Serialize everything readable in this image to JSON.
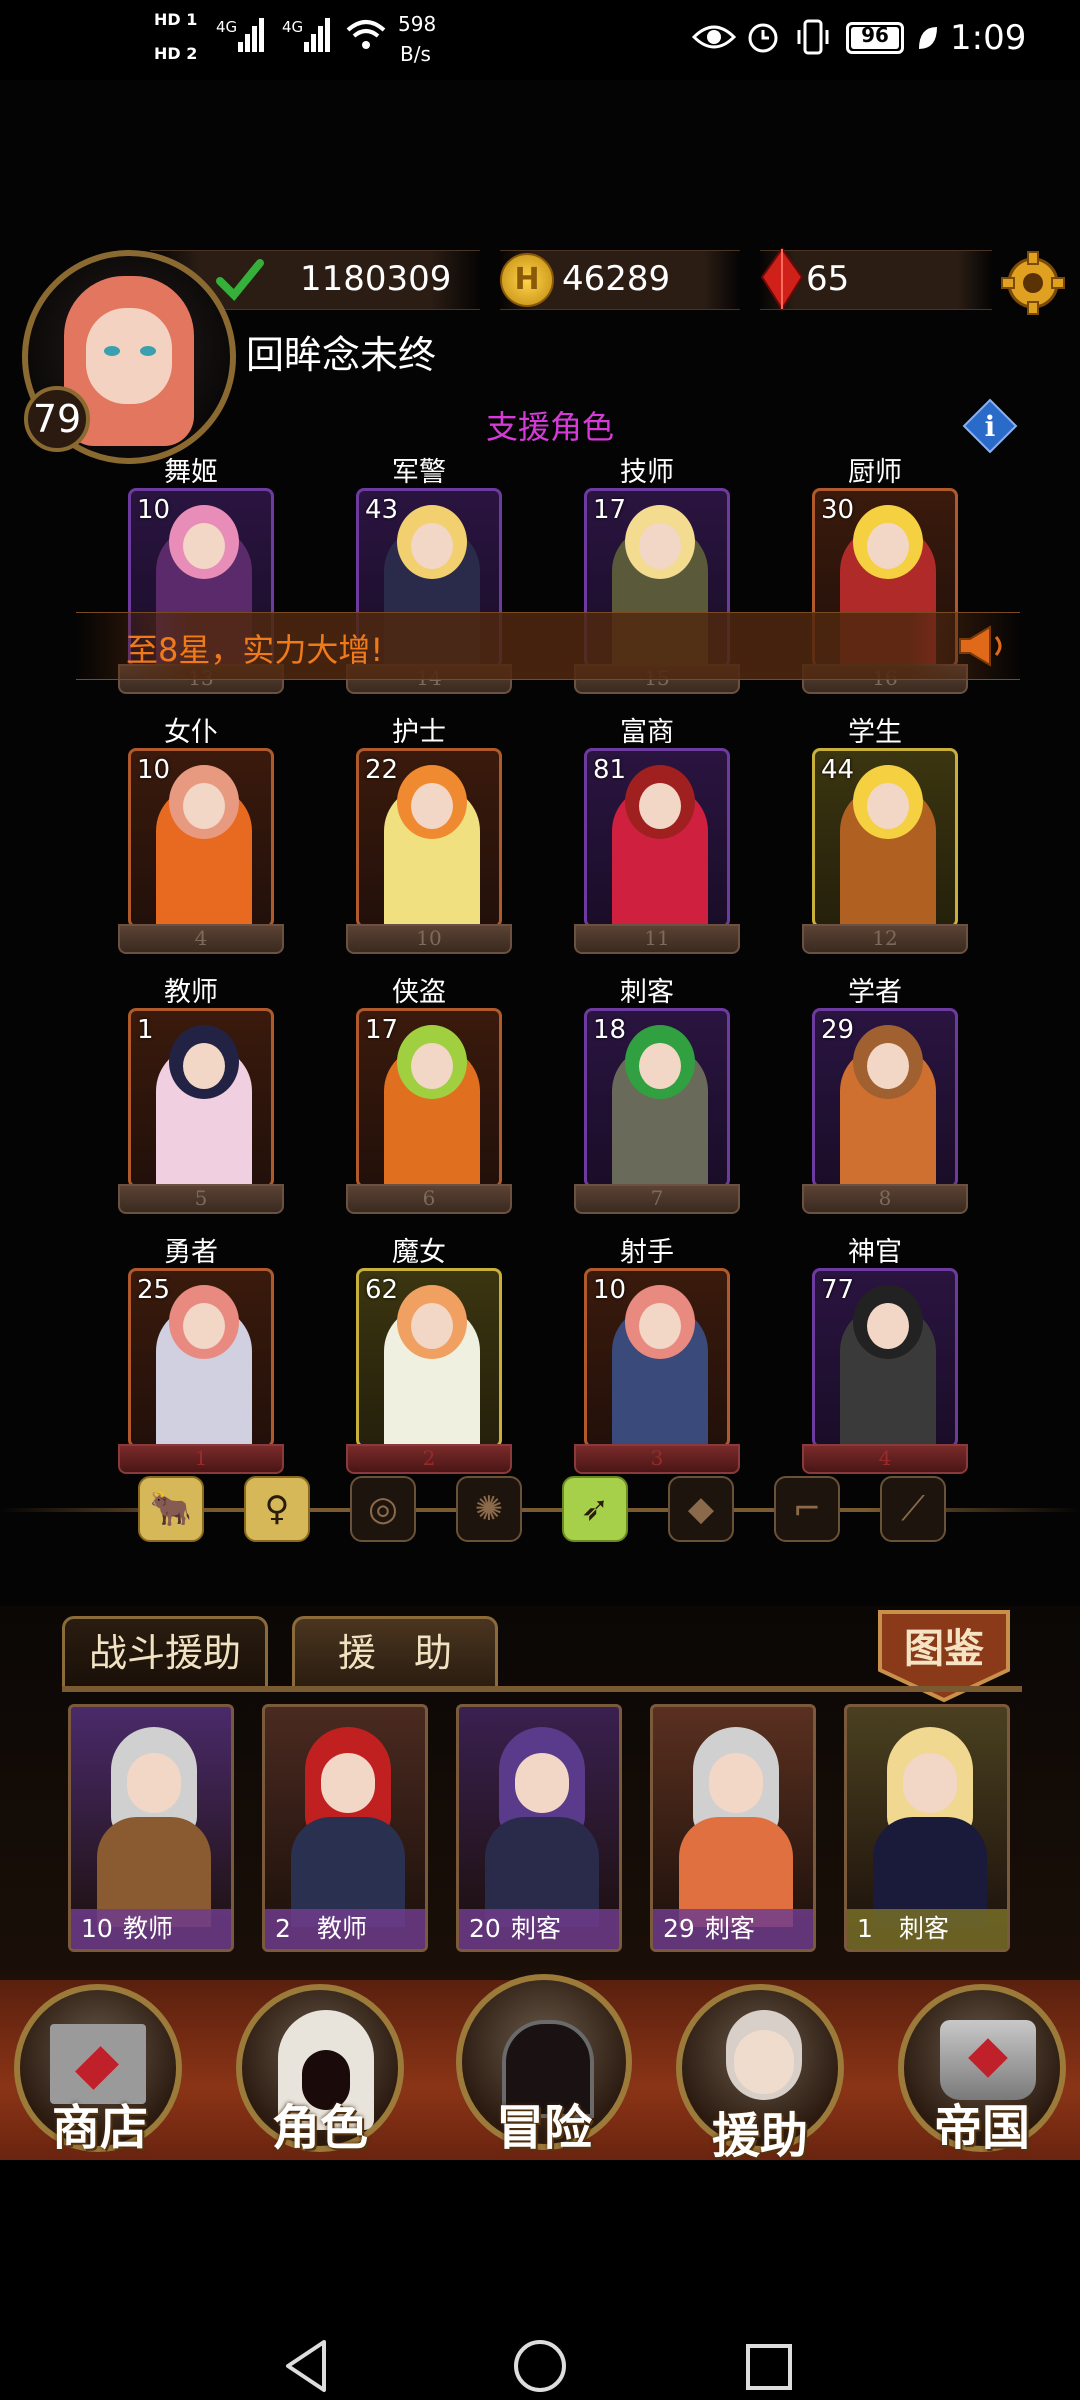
{
  "status": {
    "hd1": "HD 1",
    "hd2": "HD 2",
    "net1": "4G",
    "net2": "4G",
    "speed_value": "598",
    "speed_unit": "B/s",
    "battery": "96",
    "time": "1:09"
  },
  "header": {
    "level": "79",
    "player_name": "回眸念未终",
    "power": "1180309",
    "gold": "46289",
    "gems": "65"
  },
  "support_title": "支援角色",
  "banner_text": "至8星，实力大增!",
  "roles": [
    {
      "name": "舞姬",
      "level": "10",
      "plate": "13",
      "style": "purple",
      "hair": "#e78db7",
      "cloth": "#5a2a6a"
    },
    {
      "name": "军警",
      "level": "43",
      "plate": "14",
      "style": "purple",
      "hair": "#f2d070",
      "cloth": "#2a2a4a"
    },
    {
      "name": "技师",
      "level": "17",
      "plate": "15",
      "style": "purple",
      "hair": "#f3dc90",
      "cloth": "#5a5a3a"
    },
    {
      "name": "厨师",
      "level": "30",
      "plate": "16",
      "style": "orange",
      "hair": "#f5d040",
      "cloth": "#b02a2a"
    },
    {
      "name": "女仆",
      "level": "10",
      "plate": "4",
      "style": "orange",
      "hair": "#e89a80",
      "cloth": "#e86a20"
    },
    {
      "name": "护士",
      "level": "22",
      "plate": "10",
      "style": "orange",
      "hair": "#f08a30",
      "cloth": "#f0e080"
    },
    {
      "name": "富商",
      "level": "81",
      "plate": "11",
      "style": "purple",
      "hair": "#a02020",
      "cloth": "#d02040"
    },
    {
      "name": "学生",
      "level": "44",
      "plate": "12",
      "style": "gold",
      "hair": "#f5d040",
      "cloth": "#b06020"
    },
    {
      "name": "教师",
      "level": "1",
      "plate": "5",
      "style": "orange",
      "hair": "#222244",
      "cloth": "#f0d0e0"
    },
    {
      "name": "侠盗",
      "level": "17",
      "plate": "6",
      "style": "orange",
      "hair": "#a0d040",
      "cloth": "#e07020"
    },
    {
      "name": "刺客",
      "level": "18",
      "plate": "7",
      "style": "purple",
      "hair": "#30a040",
      "cloth": "#6a6a5a"
    },
    {
      "name": "学者",
      "level": "29",
      "plate": "8",
      "style": "purple",
      "hair": "#a06030",
      "cloth": "#d07030"
    },
    {
      "name": "勇者",
      "level": "25",
      "plate": "1",
      "style": "orange",
      "hair": "#e88a80",
      "cloth": "#d0d0e0"
    },
    {
      "name": "魔女",
      "level": "62",
      "plate": "2",
      "style": "gold",
      "hair": "#f0a060",
      "cloth": "#f0f0e0"
    },
    {
      "name": "射手",
      "level": "10",
      "plate": "3",
      "style": "orange",
      "hair": "#e88a80",
      "cloth": "#3a4a7a"
    },
    {
      "name": "神官",
      "level": "77",
      "plate": "4",
      "style": "purple",
      "hair": "#222222",
      "cloth": "#3a3a3a"
    }
  ],
  "filter_icons": [
    "beast-icon",
    "woman-icon",
    "target-icon",
    "wheel-icon",
    "bow-icon",
    "gem-icon",
    "boot-icon",
    "claw-icon"
  ],
  "tabs": {
    "battle": "战斗援助",
    "assist": "援　助",
    "encyclopedia": "图鉴"
  },
  "assist_cards": [
    {
      "level": "10",
      "role": "教师",
      "hair": "#d0d0d0",
      "cloth": "#8a5a30",
      "bg": "#4a2a6a"
    },
    {
      "level": "2",
      "role": "教师",
      "hair": "#c02020",
      "cloth": "#2a3050",
      "bg": "#4a2a20"
    },
    {
      "level": "20",
      "role": "刺客",
      "hair": "#5a3a8a",
      "cloth": "#2a2a4a",
      "bg": "#3a2050"
    },
    {
      "level": "29",
      "role": "刺客",
      "hair": "#d0d0d0",
      "cloth": "#e07040",
      "bg": "#5a3020"
    },
    {
      "level": "1",
      "role": "刺客",
      "hair": "#f0d890",
      "cloth": "#1a1a3a",
      "bg": "#4a4020"
    }
  ],
  "nav": {
    "shop": "商店",
    "role": "角色",
    "adventure": "冒险",
    "assist": "援助",
    "empire": "帝国"
  }
}
